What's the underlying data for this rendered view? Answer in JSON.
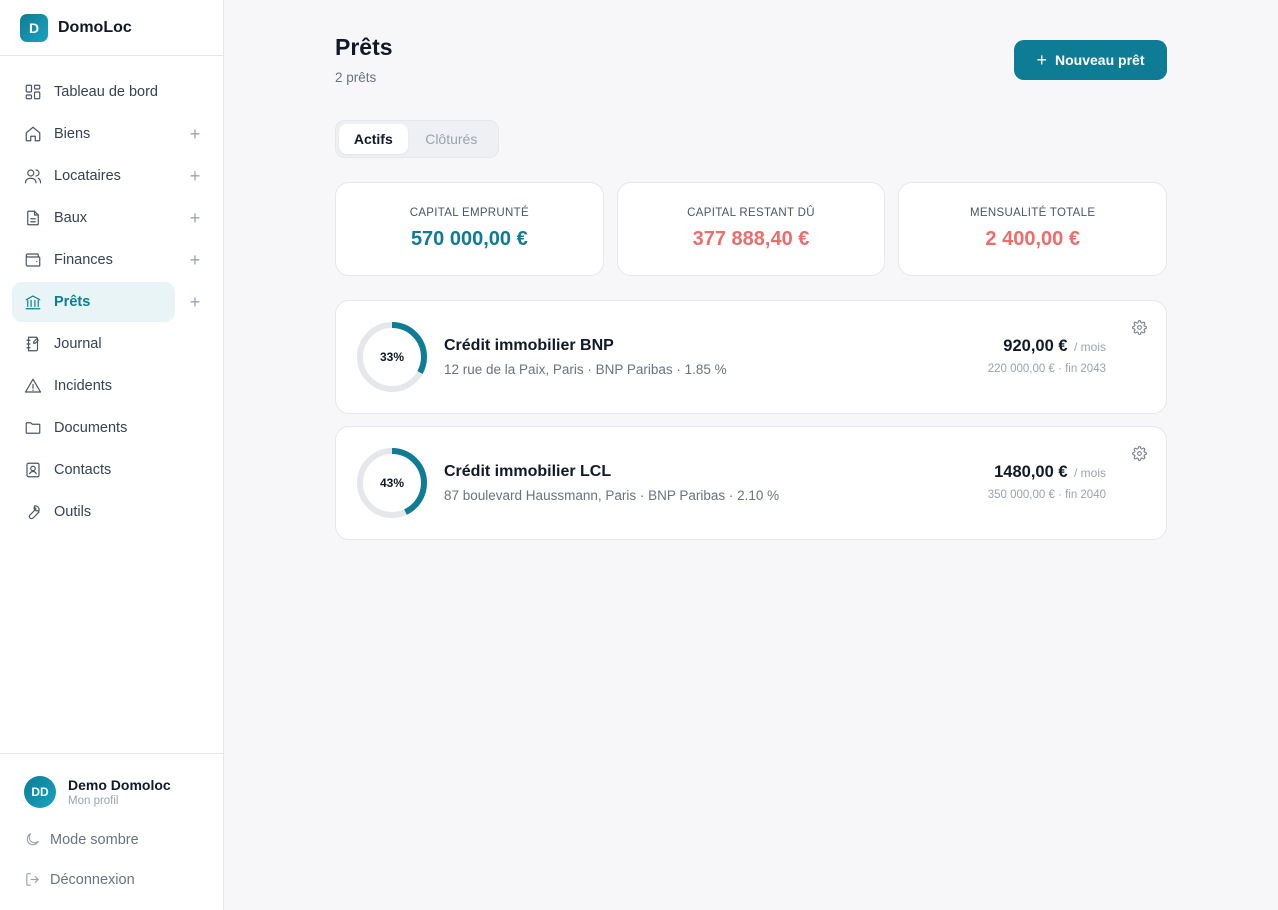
{
  "brand": {
    "logo_letter": "D",
    "name": "DomoLoc"
  },
  "sidebar": {
    "items": [
      {
        "label": "Tableau de bord",
        "icon": "dashboard-icon",
        "plus": false
      },
      {
        "label": "Biens",
        "icon": "home-icon",
        "plus": true
      },
      {
        "label": "Locataires",
        "icon": "users-icon",
        "plus": true
      },
      {
        "label": "Baux",
        "icon": "file-icon",
        "plus": true
      },
      {
        "label": "Finances",
        "icon": "wallet-icon",
        "plus": true
      },
      {
        "label": "Prêts",
        "icon": "bank-icon",
        "plus": true,
        "active": true
      },
      {
        "label": "Journal",
        "icon": "notebook-icon",
        "plus": false
      },
      {
        "label": "Incidents",
        "icon": "warning-icon",
        "plus": false
      },
      {
        "label": "Documents",
        "icon": "folder-icon",
        "plus": false
      },
      {
        "label": "Contacts",
        "icon": "contact-icon",
        "plus": false
      },
      {
        "label": "Outils",
        "icon": "wrench-icon",
        "plus": false
      }
    ],
    "plus_symbol": "+"
  },
  "footer": {
    "avatar_initials": "DD",
    "profile_name": "Demo Domoloc",
    "profile_sub": "Mon profil",
    "dark_mode_label": "Mode sombre",
    "logout_label": "Déconnexion"
  },
  "header": {
    "title": "Prêts",
    "subtitle": "2 prêts",
    "new_button_plus": "+",
    "new_button_label": "Nouveau prêt"
  },
  "tabs": {
    "active": "Actifs",
    "inactive": "Clôturés"
  },
  "stats": [
    {
      "label": "CAPITAL EMPRUNTÉ",
      "value": "570 000,00 €",
      "color": "#0e7c94"
    },
    {
      "label": "CAPITAL RESTANT DÛ",
      "value": "377 888,40 €",
      "color": "#f06b6b"
    },
    {
      "label": "MENSUALITÉ TOTALE",
      "value": "2 400,00 €",
      "color": "#f06b6b"
    }
  ],
  "loans": [
    {
      "progress_label": "33%",
      "progress": 0.33,
      "title": "Crédit immobilier BNP",
      "meta": "12 rue de la Paix, Paris · BNP Paribas · 1.85 %",
      "amount": "920,00 €",
      "per": "/ mois",
      "detail": "220 000,00 € · fin 2043"
    },
    {
      "progress_label": "43%",
      "progress": 0.43,
      "title": "Crédit immobilier LCL",
      "meta": "87 boulevard Haussmann, Paris · BNP Paribas · 2.10 %",
      "amount": "1480,00 €",
      "per": "/ mois",
      "detail": "350 000,00 € · fin 2040"
    }
  ],
  "colors": {
    "accent": "#0e7c94",
    "danger": "#f06b6b",
    "ring_track": "#e5e7eb"
  }
}
